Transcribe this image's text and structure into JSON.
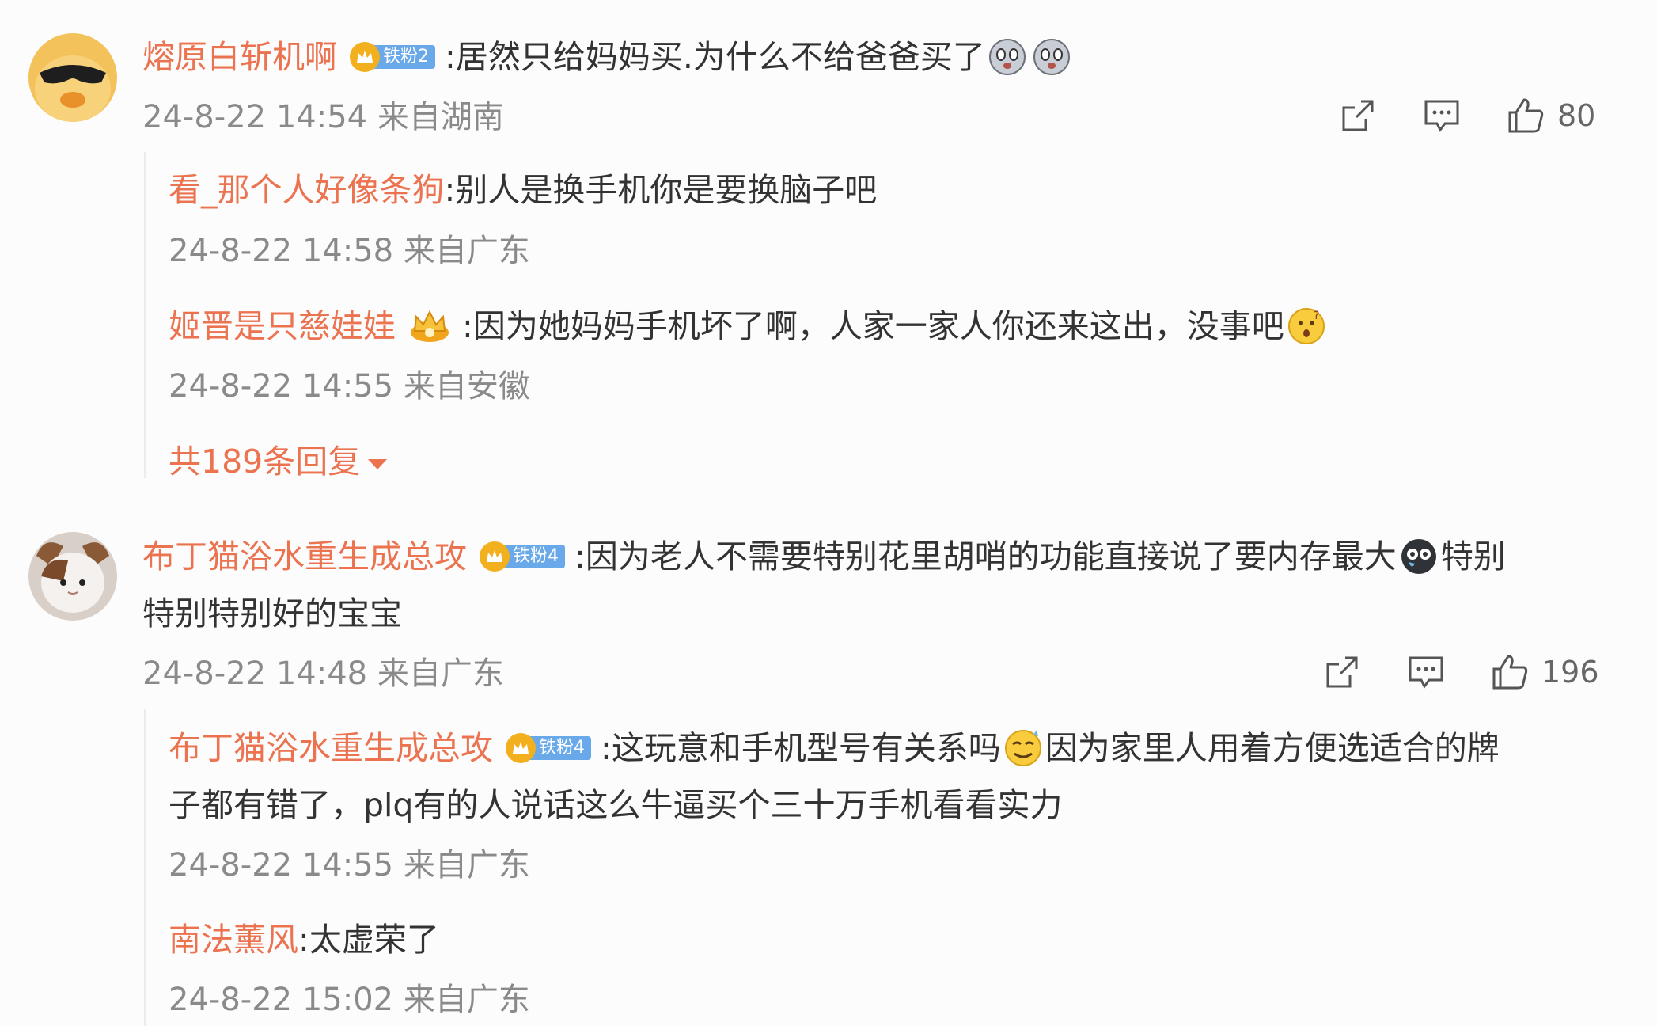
{
  "comments": [
    {
      "user": "熔原白斩机啊",
      "badge": "铁粉2",
      "text": ":居然只给妈妈买.为什么不给爸爸买了",
      "time": "24-8-22 14:54 来自湖南",
      "likes": "80",
      "replies": [
        {
          "user": "看_那个人好像条狗",
          "text": ":别人是换手机你是要换脑子吧",
          "time": "24-8-22 14:58 来自广东"
        },
        {
          "user": "姬晋是只慈娃娃",
          "text": ":因为她妈妈手机坏了啊，人家一家人你还来这出，没事吧",
          "time": "24-8-22 14:55 来自安徽"
        }
      ],
      "more_replies": "共189条回复"
    },
    {
      "user": "布丁猫浴水重生成总攻",
      "badge": "铁粉4",
      "text_line1": ":因为老人不需要特别花里胡哨的功能直接说了要内存最大",
      "text_line1b": "特别",
      "text_line2": "特别特别好的宝宝",
      "time": "24-8-22 14:48 来自广东",
      "likes": "196",
      "replies": [
        {
          "user": "布丁猫浴水重生成总攻",
          "badge": "铁粉4",
          "text_line1": ":这玩意和手机型号有关系吗",
          "text_line1b": "因为家里人用着方便选适合的牌",
          "text_line2": "子都有错了，plq有的人说话这么牛逼买个三十万手机看看实力",
          "time": "24-8-22 14:55 来自广东"
        },
        {
          "user": "南法薰风",
          "text": ":太虚荣了",
          "time": "24-8-22 15:02 来自广东"
        }
      ]
    }
  ],
  "icons": {
    "share": "share-icon",
    "comment": "comment-icon",
    "like": "thumbs-up-icon"
  },
  "colors": {
    "username": "#eb7350",
    "text": "#333333",
    "meta": "#8a8a8a",
    "badge": "#6aa9e9"
  }
}
